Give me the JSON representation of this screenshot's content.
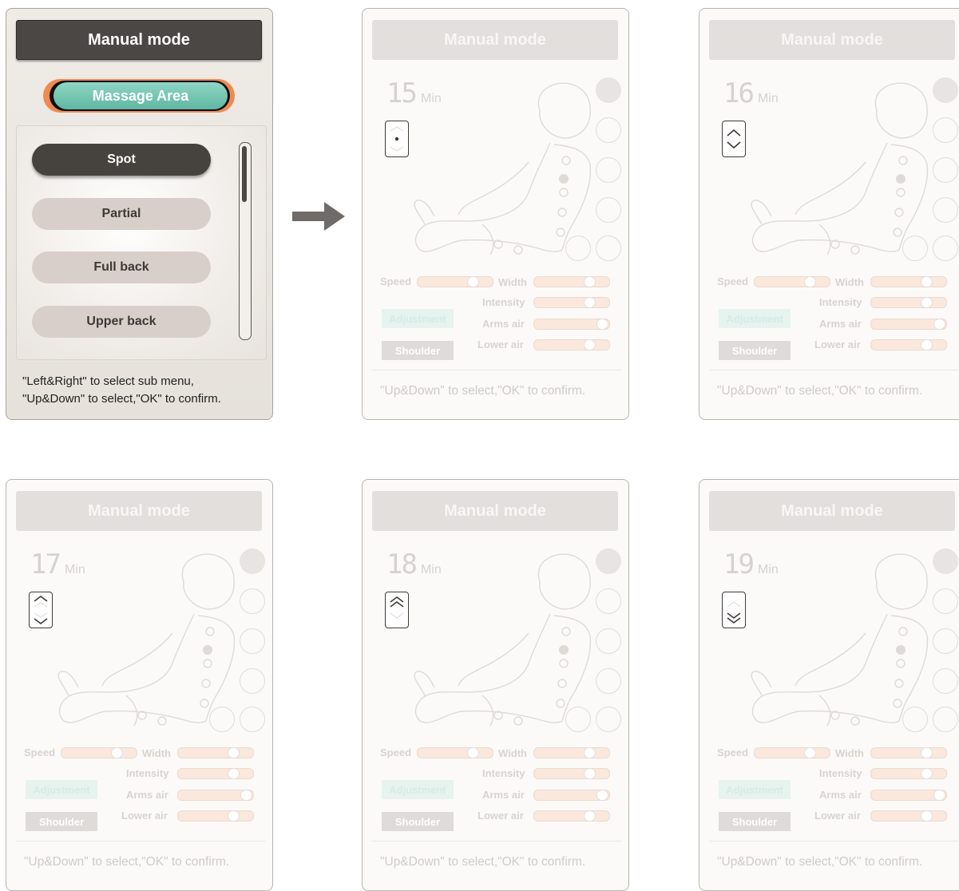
{
  "active_panel": {
    "title": "Manual mode",
    "massage_area_label": "Massage Area",
    "items": [
      "Spot",
      "Partial",
      "Full back",
      "Upper back"
    ],
    "selected_item": "Spot",
    "hint_line1": "\"Left&Right\" to select sub menu,",
    "hint_line2": "\"Up&Down\" to select,\"OK\" to confirm."
  },
  "arrow_icon": "right-arrow-icon",
  "faded_panels": [
    {
      "title": "Manual mode",
      "timer_value": "15",
      "timer_unit": "Min",
      "mode_icon": "spot-mode-icon",
      "labels": {
        "speed": "Speed",
        "width": "Width",
        "intensity": "Intensity",
        "arms_air": "Arms air",
        "lower_air": "Lower air",
        "adjustment": "Adjustment",
        "shoulder": "Shoulder"
      },
      "hint": "\"Up&Down\" to select,\"OK\" to confirm."
    },
    {
      "title": "Manual mode",
      "timer_value": "16",
      "timer_unit": "Min",
      "mode_icon": "partial-mode-icon",
      "labels": {
        "speed": "Speed",
        "width": "Width",
        "intensity": "Intensity",
        "arms_air": "Arms air",
        "lower_air": "Lower air",
        "adjustment": "Adjustment",
        "shoulder": "Shoulder"
      },
      "hint": "\"Up&Down\" to select,\"OK\" to confirm."
    },
    {
      "title": "Manual mode",
      "timer_value": "17",
      "timer_unit": "Min",
      "mode_icon": "full-back-mode-icon",
      "labels": {
        "speed": "Speed",
        "width": "Width",
        "intensity": "Intensity",
        "arms_air": "Arms air",
        "lower_air": "Lower air",
        "adjustment": "Adjustment",
        "shoulder": "Shoulder"
      },
      "hint": "\"Up&Down\" to select,\"OK\" to confirm."
    },
    {
      "title": "Manual mode",
      "timer_value": "18",
      "timer_unit": "Min",
      "mode_icon": "upper-back-mode-icon",
      "labels": {
        "speed": "Speed",
        "width": "Width",
        "intensity": "Intensity",
        "arms_air": "Arms air",
        "lower_air": "Lower air",
        "adjustment": "Adjustment",
        "shoulder": "Shoulder"
      },
      "hint": "\"Up&Down\" to select,\"OK\" to confirm."
    },
    {
      "title": "Manual mode",
      "timer_value": "19",
      "timer_unit": "Min",
      "mode_icon": "lower-back-mode-icon",
      "labels": {
        "speed": "Speed",
        "width": "Width",
        "intensity": "Intensity",
        "arms_air": "Arms air",
        "lower_air": "Lower air",
        "adjustment": "Adjustment",
        "shoulder": "Shoulder"
      },
      "hint": "\"Up&Down\" to select,\"OK\" to confirm."
    }
  ]
}
